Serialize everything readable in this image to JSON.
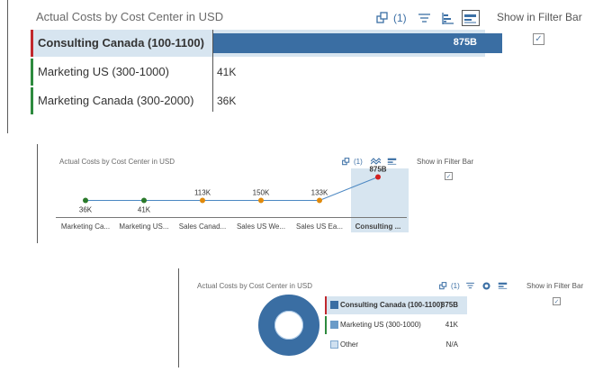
{
  "colors": {
    "bar": "#3a6ea3",
    "selected_bg": "#d7e5f0",
    "accent_red": "#c0282d",
    "accent_green": "#2d8a3e",
    "point_green": "#2b7a2b",
    "point_orange": "#e08a0c",
    "point_red": "#d32020",
    "line": "#4b87c2",
    "donut": "#3a6ea3",
    "legend_light": "#a9c8e6"
  },
  "panel1": {
    "title": "Actual Costs by Cost Center in USD",
    "filter_count": "(1)",
    "filter_bar_label": "Show in Filter Bar",
    "filter_checked": "✓",
    "rows": [
      {
        "label": "Consulting Canada (100-1100)",
        "value": "875B"
      },
      {
        "label": "Marketing US (300-1000)",
        "value": "41K"
      },
      {
        "label": "Marketing Canada (300-2000)",
        "value": "36K"
      }
    ]
  },
  "panel2": {
    "title": "Actual Costs by Cost Center in USD",
    "filter_count": "(1)",
    "filter_bar_label": "Show in Filter Bar",
    "filter_checked": "✓",
    "chart_data": {
      "type": "line",
      "categories": [
        "Marketing Ca...",
        "Marketing US...",
        "Sales Canad...",
        "Sales US We...",
        "Sales US Ea...",
        "Consulting ..."
      ],
      "data_labels": [
        "36K",
        "41K",
        "113K",
        "150K",
        "133K",
        "875B"
      ],
      "point_colors": [
        "green",
        "green",
        "orange",
        "orange",
        "orange",
        "red"
      ],
      "selected_category": "Consulting ..."
    }
  },
  "panel3": {
    "title": "Actual Costs by Cost Center in USD",
    "filter_count": "(1)",
    "filter_bar_label": "Show in Filter Bar",
    "filter_checked": "✓",
    "chart_data": {
      "type": "pie",
      "legend": [
        {
          "label": "Consulting Canada (100-1100)",
          "value": "875B"
        },
        {
          "label": "Marketing US (300-1000)",
          "value": "41K"
        },
        {
          "label": "Other",
          "value": "N/A"
        }
      ]
    }
  }
}
